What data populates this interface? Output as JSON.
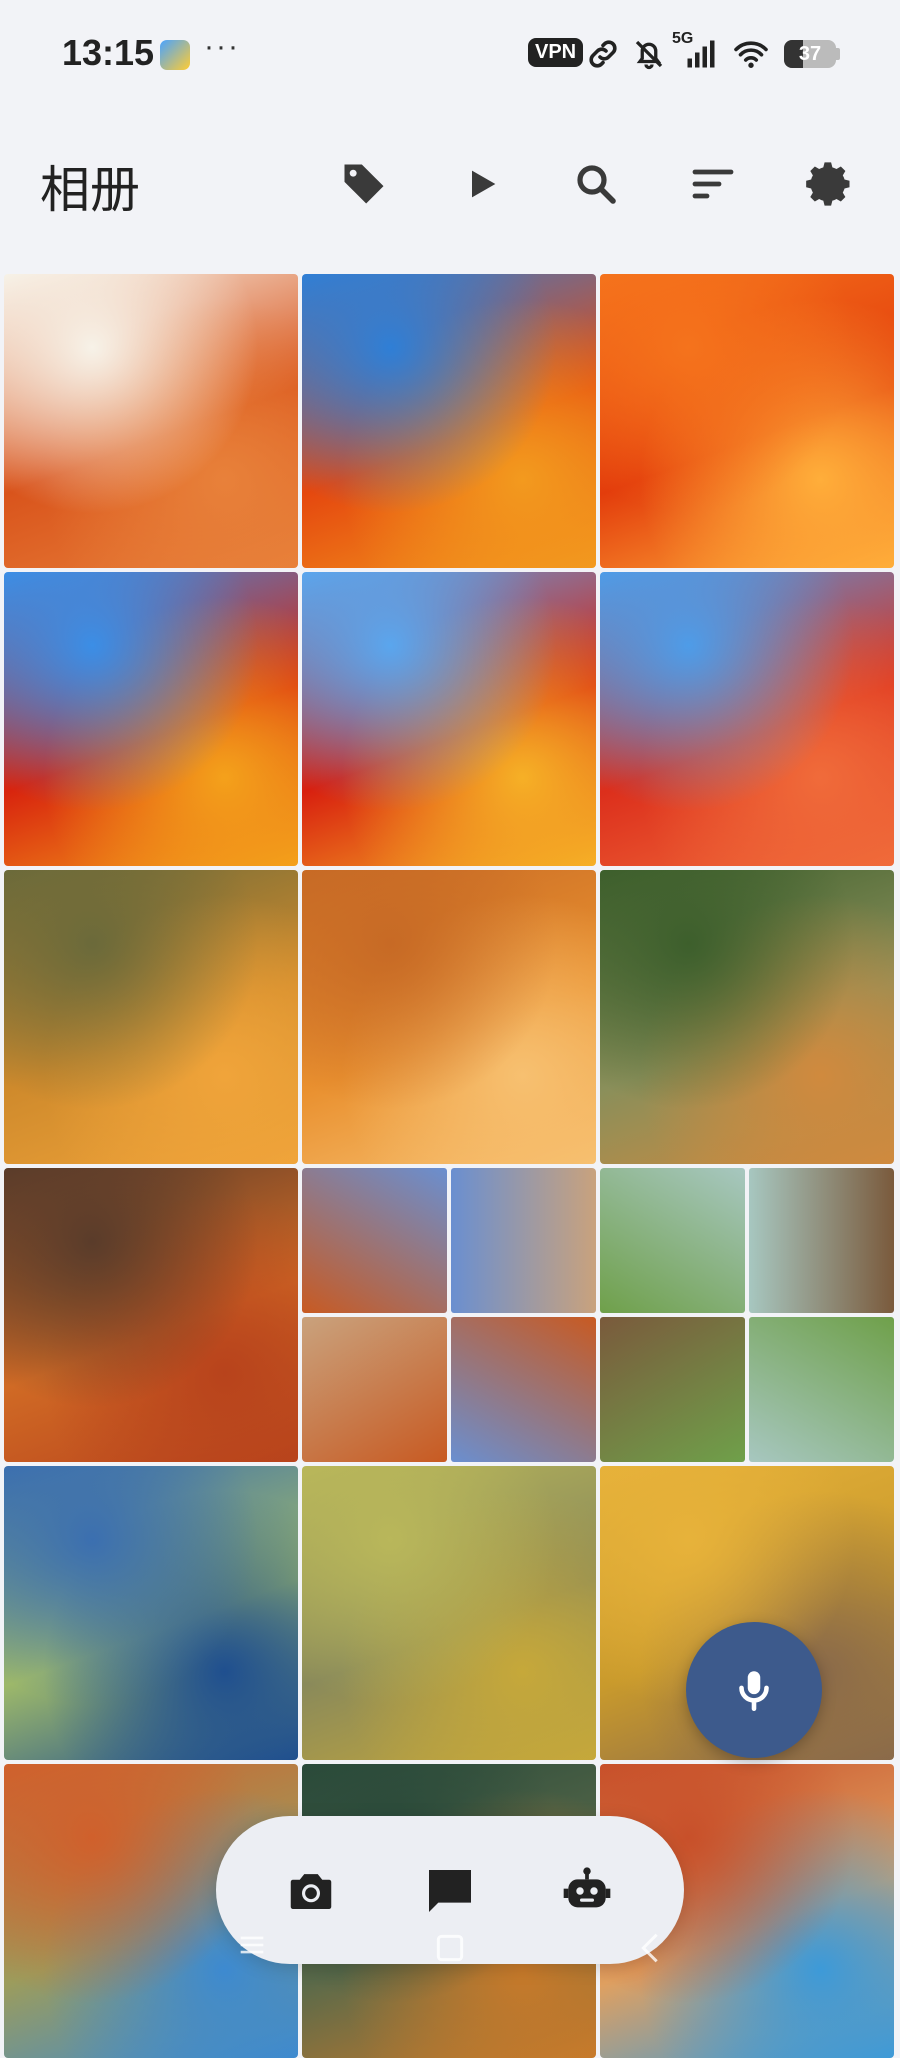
{
  "status_bar": {
    "time": "13:15",
    "overflow": "···",
    "vpn_label": "VPN",
    "network_label": "5G",
    "battery_level": "37",
    "icons": [
      "app-badge-icon",
      "link-icon",
      "mute-bell-icon",
      "signal-icon",
      "wifi-icon",
      "battery-icon"
    ]
  },
  "app_bar": {
    "title": "相册",
    "actions": [
      "tag-icon",
      "play-icon",
      "search-icon",
      "sort-icon",
      "gear-icon"
    ]
  },
  "grid": {
    "tiles": [
      {
        "name": "photo-1",
        "colors": [
          "#f7f2e8",
          "#d9541c",
          "#e8813a"
        ]
      },
      {
        "name": "photo-2",
        "colors": [
          "#2f7fd6",
          "#e5480f",
          "#f39a1e"
        ]
      },
      {
        "name": "photo-3",
        "colors": [
          "#f5731c",
          "#e33d0c",
          "#ffae3a"
        ]
      },
      {
        "name": "photo-4",
        "colors": [
          "#3b8ee6",
          "#d8240e",
          "#f4a11b"
        ]
      },
      {
        "name": "photo-5",
        "colors": [
          "#5aa6ee",
          "#d8200f",
          "#f6b026"
        ]
      },
      {
        "name": "photo-6",
        "colors": [
          "#4e9ce8",
          "#dc2f1c",
          "#f06b3a"
        ]
      },
      {
        "name": "photo-7",
        "colors": [
          "#6b6a3a",
          "#cf8a2c",
          "#f0a43a"
        ]
      },
      {
        "name": "photo-8",
        "colors": [
          "#c76a25",
          "#e9902f",
          "#f7c070"
        ]
      },
      {
        "name": "photo-9",
        "colors": [
          "#3d5f2c",
          "#8a8f5a",
          "#d08a3e"
        ]
      },
      {
        "name": "photo-10",
        "colors": [
          "#5a3c2a",
          "#d06a25",
          "#b8431c"
        ]
      },
      {
        "name": "photo-11-collage",
        "colors": [
          "#c85a22",
          "#6a8fd0",
          "#c9a27d"
        ]
      },
      {
        "name": "photo-12-collage",
        "colors": [
          "#6fa04a",
          "#a7c7c0",
          "#7a5a3c"
        ]
      },
      {
        "name": "photo-13",
        "colors": [
          "#3b6fb0",
          "#9db86a",
          "#1f4f8f"
        ]
      },
      {
        "name": "photo-14",
        "colors": [
          "#b9b75a",
          "#8a8a5a",
          "#c6a83a"
        ]
      },
      {
        "name": "photo-15",
        "colors": [
          "#e7b23a",
          "#c99a2c",
          "#8a6a4a"
        ]
      },
      {
        "name": "photo-16",
        "colors": [
          "#d0602c",
          "#9c9c5c",
          "#3d8ad0"
        ]
      },
      {
        "name": "photo-17",
        "colors": [
          "#2a4a3a",
          "#5a6a4a",
          "#c87a2a"
        ]
      },
      {
        "name": "photo-18",
        "colors": [
          "#c8502a",
          "#e0a060",
          "#3d9ad8"
        ]
      }
    ]
  },
  "fab": {
    "icon": "microphone-icon"
  },
  "bottom_bar": {
    "buttons": [
      "camera-icon",
      "chat-icon",
      "robot-icon"
    ]
  },
  "nav_bar": {
    "items": [
      "menu-nav-icon",
      "home-nav-icon",
      "back-nav-icon"
    ]
  }
}
